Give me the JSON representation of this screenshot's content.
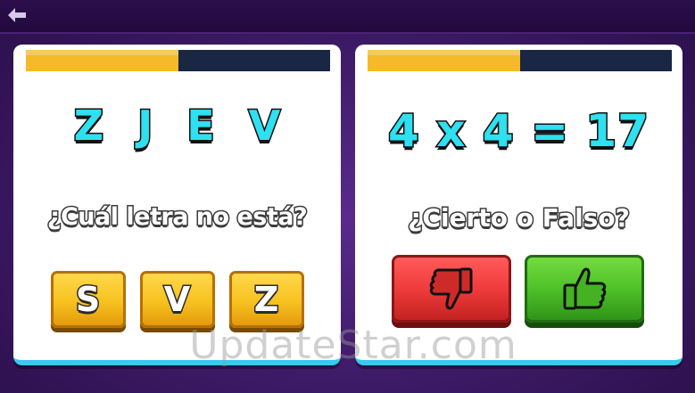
{
  "header": {
    "back_icon": "back-arrow-icon"
  },
  "colors": {
    "timer_fill": "#f5b92a",
    "timer_track": "#1a2744",
    "accent_cyan": "#2ee0f0",
    "false_red": "#ef3b3b",
    "true_green": "#4fc12a",
    "option_gold": "#f7c21f"
  },
  "left_card": {
    "timer_progress": 0.5,
    "letters": [
      "Z",
      "J",
      "E",
      "V"
    ],
    "question": "¿Cuál letra no está?",
    "options": [
      "S",
      "V",
      "Z"
    ]
  },
  "right_card": {
    "timer_progress": 0.5,
    "equation": "4 x 4 = 17",
    "question": "¿Cierto o Falso?",
    "false_icon": "thumbs-down-icon",
    "true_icon": "thumbs-up-icon"
  },
  "watermark": "UpdateStar.com"
}
